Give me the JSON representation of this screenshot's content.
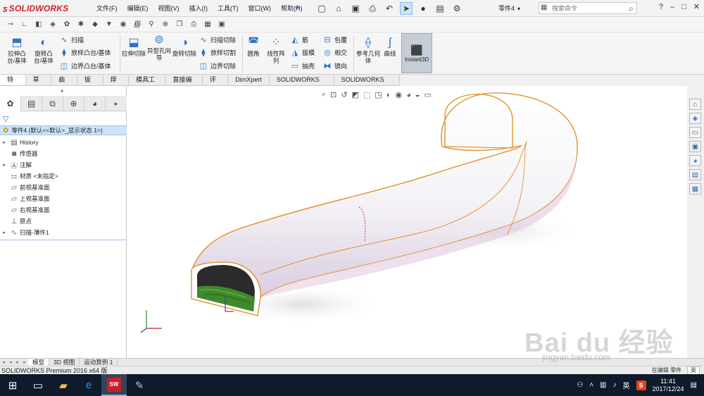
{
  "app": {
    "logo_text": "SOLIDWORKS",
    "menus": [
      "文件(F)",
      "编辑(E)",
      "视图(V)",
      "插入(I)",
      "工具(T)",
      "窗口(W)",
      "帮助(H)"
    ],
    "part_name": "零件4",
    "search_placeholder": "搜索命令",
    "help": "?",
    "window_controls": [
      "–",
      "□",
      "✕"
    ]
  },
  "commands": {
    "extrude_boss": "拉伸凸台/基体",
    "revolve_boss": "旋转凸台/基体",
    "sweep": "扫描",
    "loft_boss": "放样凸台/基体",
    "boundary_boss": "边界凸台/基体",
    "extrude_cut": "拉伸切除",
    "hole_wizard": "异型孔向导",
    "revolve_cut": "旋转切除",
    "swept_cut": "扫描切除",
    "lofted_cut": "放样切割",
    "boundary_cut": "边界切除",
    "fillet": "圆角",
    "linear_pattern": "线性阵列",
    "rib": "筋",
    "draft": "拔模",
    "shell": "抽壳",
    "wrap": "包覆",
    "intersect": "相交",
    "mirror": "镜向",
    "ref_geometry": "参考几何体",
    "curves": "曲线",
    "instant3d": "Instant3D"
  },
  "tabs": [
    "特征",
    "草图",
    "曲面",
    "钣金",
    "焊件",
    "模具工具",
    "直接编辑",
    "评估",
    "DimXpert",
    "SOLIDWORKS 插件",
    "SOLIDWORKS MBD"
  ],
  "tree": {
    "root": "零件4  (默认<<默认>_显示状态 1>)",
    "items": [
      {
        "label": "History",
        "icon": "history-icon",
        "expander": "▸"
      },
      {
        "label": "传感器",
        "icon": "sensor-icon",
        "expander": ""
      },
      {
        "label": "注解",
        "icon": "annotation-icon",
        "expander": "▸"
      },
      {
        "label": "材质 <未指定>",
        "icon": "material-icon",
        "expander": ""
      },
      {
        "label": "前视基准面",
        "icon": "plane-icon",
        "expander": ""
      },
      {
        "label": "上视基准面",
        "icon": "plane-icon",
        "expander": ""
      },
      {
        "label": "右视基准面",
        "icon": "plane-icon",
        "expander": ""
      },
      {
        "label": "原点",
        "icon": "origin-icon",
        "expander": ""
      },
      {
        "label": "扫描-薄件1",
        "icon": "sweep-feature-icon",
        "expander": "▸"
      }
    ]
  },
  "bottom_tabs": [
    "模型",
    "3D 视图",
    "运动算例 1"
  ],
  "status": {
    "text": "SOLIDWORKS Premium 2016 x64 版",
    "right": [
      "在编辑 零件",
      "英"
    ]
  },
  "taskbar": {
    "time": "11:41",
    "date": "2017/12/24",
    "ime": "英",
    "sw_label": "SW"
  },
  "watermark": {
    "text": "Bai du 经验",
    "url": "jingyan.baidu.com"
  },
  "colors": {
    "accent": "#2e73c4",
    "brand": "#d12027",
    "edge": "#e08a1e",
    "grass": "#3f8a2c",
    "selection": "#cde3f8"
  }
}
